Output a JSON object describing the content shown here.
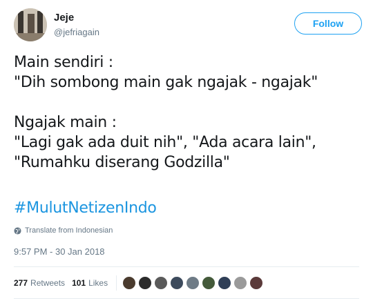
{
  "user": {
    "name": "Jeje",
    "handle": "@jefriagain"
  },
  "follow_label": "Follow",
  "tweet": {
    "lines": [
      "Main sendiri :",
      "\"Dih sombong main gak ngajak - ngajak\"",
      "",
      "Ngajak main :",
      "\"Lagi gak ada duit nih\", \"Ada acara lain\",",
      "\"Rumahku diserang Godzilla\""
    ],
    "hashtag": "#MulutNetizenIndo"
  },
  "translate_label": "Translate from Indonesian",
  "timestamp": "9:57 PM - 30 Jan 2018",
  "stats": {
    "retweets_count": "277",
    "retweets_label": "Retweets",
    "likes_count": "101",
    "likes_label": "Likes"
  },
  "colors": {
    "accent": "#1da1f2",
    "hashtag": "#1b95e0",
    "secondary_text": "#657786"
  },
  "likers": [
    {
      "color": "#4a3b2e"
    },
    {
      "color": "#2b2b2b"
    },
    {
      "color": "#5a5a5a"
    },
    {
      "color": "#3c4a5c"
    },
    {
      "color": "#6e7b86"
    },
    {
      "color": "#445a3a"
    },
    {
      "color": "#2f3f57"
    },
    {
      "color": "#9a9a9a"
    },
    {
      "color": "#5b3a3a"
    }
  ]
}
